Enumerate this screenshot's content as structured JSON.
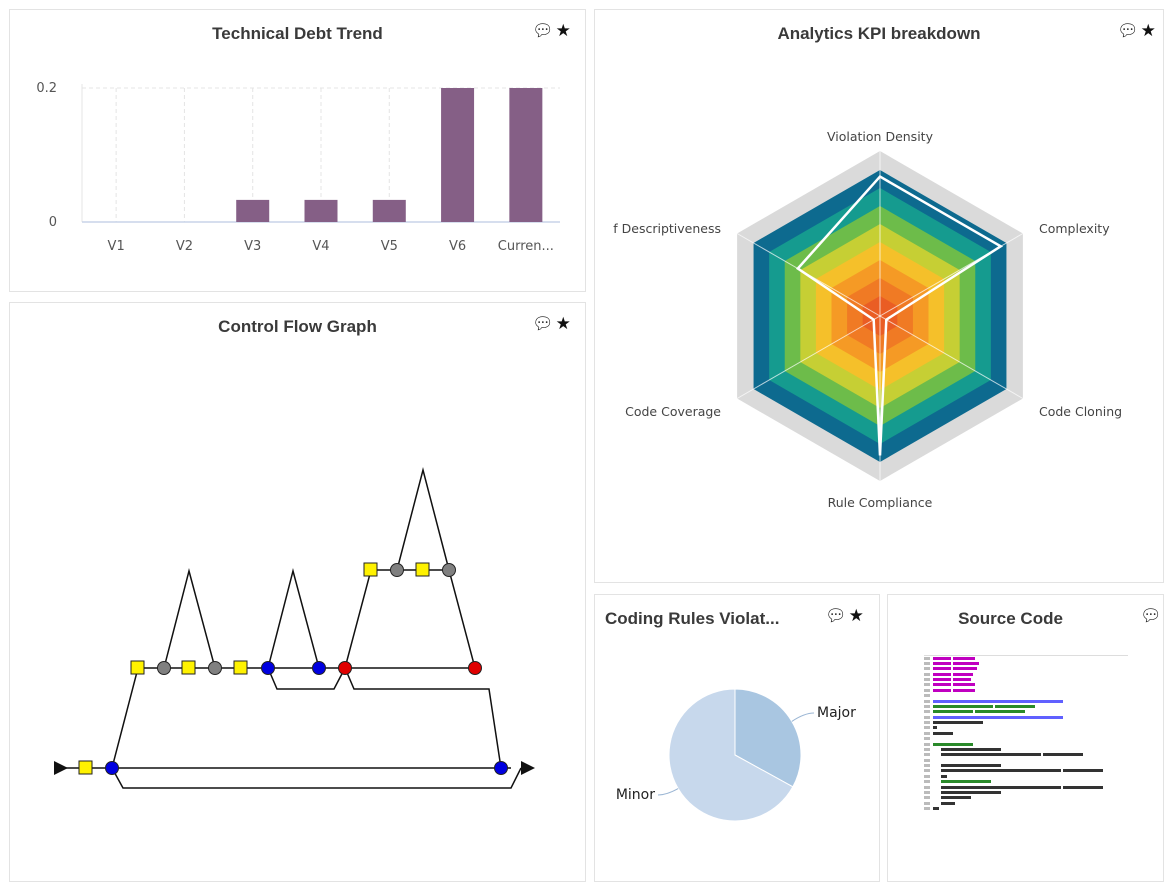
{
  "panels": {
    "debt": {
      "title": "Technical Debt Trend"
    },
    "kpi": {
      "title": "Analytics KPI breakdown"
    },
    "cfg": {
      "title": "Control Flow Graph"
    },
    "rules": {
      "title": "Coding Rules Violat..."
    },
    "source": {
      "title": "Source Code"
    }
  },
  "icons": {
    "comment": "comment-icon",
    "star": "star-icon"
  },
  "colors": {
    "bar": "#855f86",
    "radar_rings": [
      "#0d6a8f",
      "#159b8f",
      "#6dbc4a",
      "#c6cf34",
      "#f5c02a",
      "#f59a25",
      "#f07a24",
      "#ea5d24"
    ],
    "radar_outer": "#dadada",
    "pie_major": "#a9c6e1",
    "pie_minor": "#c7d8ec"
  },
  "chart_data": [
    {
      "id": "technical-debt-trend",
      "type": "bar",
      "title": "Technical Debt Trend",
      "categories": [
        "V1",
        "V2",
        "V3",
        "V4",
        "V5",
        "V6",
        "Curren..."
      ],
      "values": [
        0,
        0,
        0.033,
        0.033,
        0.033,
        0.2,
        0.2
      ],
      "yticks": [
        "0.2",
        "0"
      ],
      "ylim": [
        0,
        0.2
      ],
      "xlabel": "",
      "ylabel": "",
      "grid": true
    },
    {
      "id": "analytics-kpi-breakdown",
      "type": "radar",
      "title": "Analytics KPI breakdown",
      "axes": [
        "Violation Density",
        "Complexity",
        "Code Cloning",
        "Rule Compliance",
        "Code Coverage",
        "f Descriptiveness"
      ],
      "series": [
        {
          "values": [
            0.9,
            0.9,
            0.05,
            0.9,
            0.05,
            0.65
          ]
        }
      ],
      "range": [
        0,
        1
      ]
    },
    {
      "id": "coding-rules-violations",
      "type": "pie",
      "title": "Coding Rules Violat...",
      "labels": [
        "Major",
        "Minor"
      ],
      "values": [
        33,
        67
      ]
    }
  ]
}
